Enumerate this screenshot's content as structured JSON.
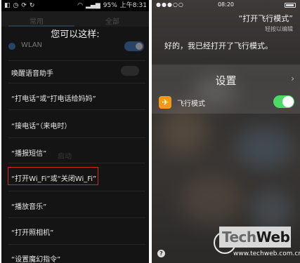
{
  "left": {
    "status": {
      "battery": "95%",
      "time": "上午8:31",
      "icons_left": [
        "notification-icon",
        "clock-icon",
        "sync-icon",
        "loop-icon"
      ],
      "icons_right": [
        "wifi-icon",
        "signal-icon",
        "battery-icon"
      ]
    },
    "background_tabs": [
      "常用",
      "全部"
    ],
    "overlay_title": "您可以这样:",
    "background_row": "WLAN",
    "background_hint": "启动",
    "commands": [
      "唤醒语音助手",
      "“打电话”或“打电话给妈妈”",
      "“接电话”（来电时）",
      "“播报短信”",
      "“打开Wi_Fi”或“关闭Wi_Fi”",
      "“播放音乐”",
      "“打开照相机”",
      "“设置魔幻指令”"
    ],
    "highlighted_index": 4
  },
  "right": {
    "status": {
      "signal": "●●●○○",
      "time": "08:20"
    },
    "query": "“打开飞行模式”",
    "edit_hint": "轻按以编辑",
    "answer": "好的，我已经打开了飞行模式。",
    "settings_title": "设置",
    "airplane_label": "飞行模式",
    "airplane_on": true,
    "help_label": "?"
  },
  "watermark": {
    "logo_tech": "Tech",
    "logo_web": "Web",
    "url": "www.techweb.com.cn"
  },
  "colors": {
    "highlight_border": "#d2261d",
    "airplane_icon_bg": "#f19a1a",
    "ios_switch_on": "#4cd964"
  }
}
